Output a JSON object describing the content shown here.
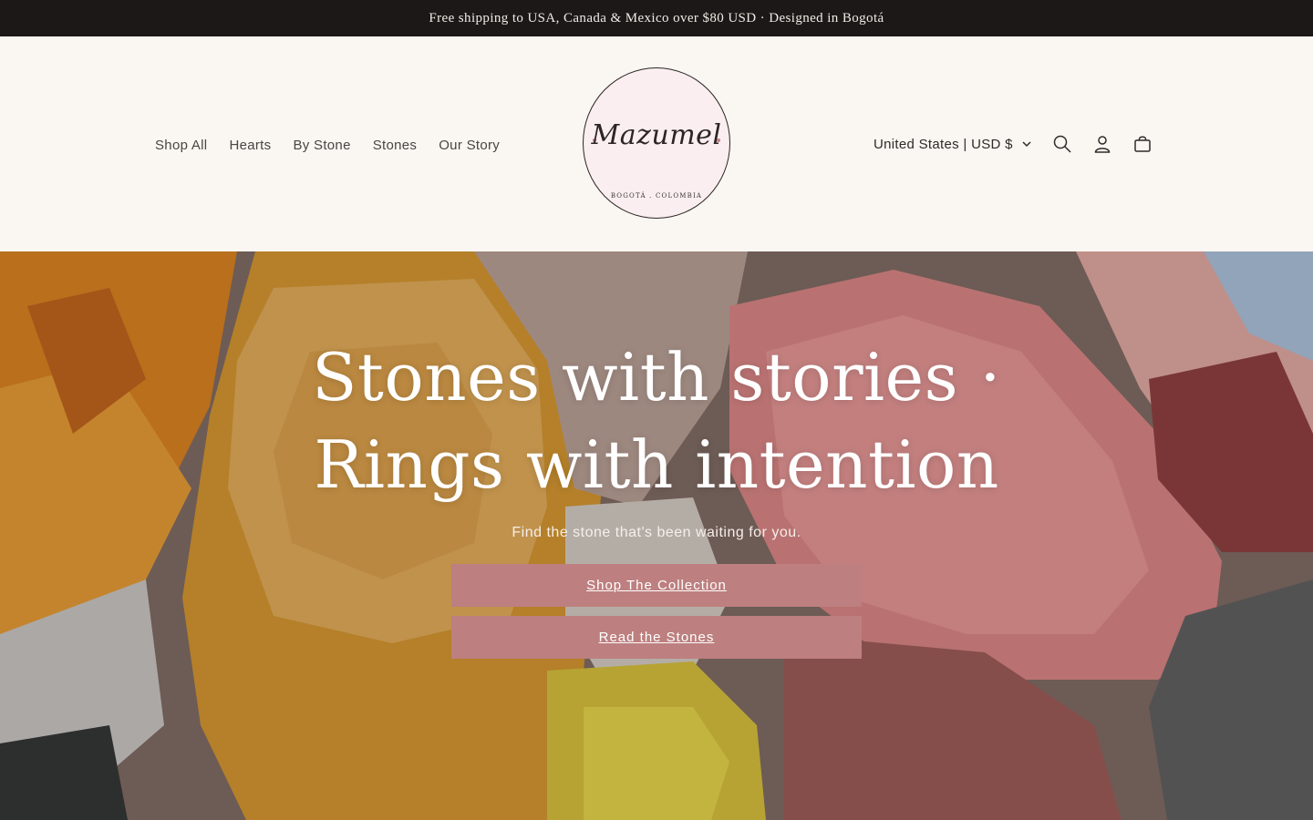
{
  "announcement": "Free shipping to USA, Canada & Mexico over $80 USD · Designed in Bogotá",
  "nav": {
    "items": [
      {
        "label": "Shop All"
      },
      {
        "label": "Hearts"
      },
      {
        "label": "By Stone"
      },
      {
        "label": "Stones"
      },
      {
        "label": "Our Story"
      }
    ]
  },
  "logo": {
    "wordmark": "Mazumel",
    "sub": "BOGOTÁ . COLOMBIA"
  },
  "header_right": {
    "country_label": "United States | USD $",
    "icons": [
      "search-icon",
      "account-icon",
      "cart-icon"
    ]
  },
  "hero": {
    "title_line1": "Stones with stories ·",
    "title_line2": "Rings with intention",
    "subtitle": "Find the stone that's been waiting for you.",
    "primary_button": "Shop The Collection",
    "secondary_button": "Read the Stones"
  },
  "colors": {
    "announcement_bg": "#1c1817",
    "header_bg": "#faf6f2",
    "button_bg": "#bd7f7f",
    "logo_fill": "#fbeef0"
  }
}
